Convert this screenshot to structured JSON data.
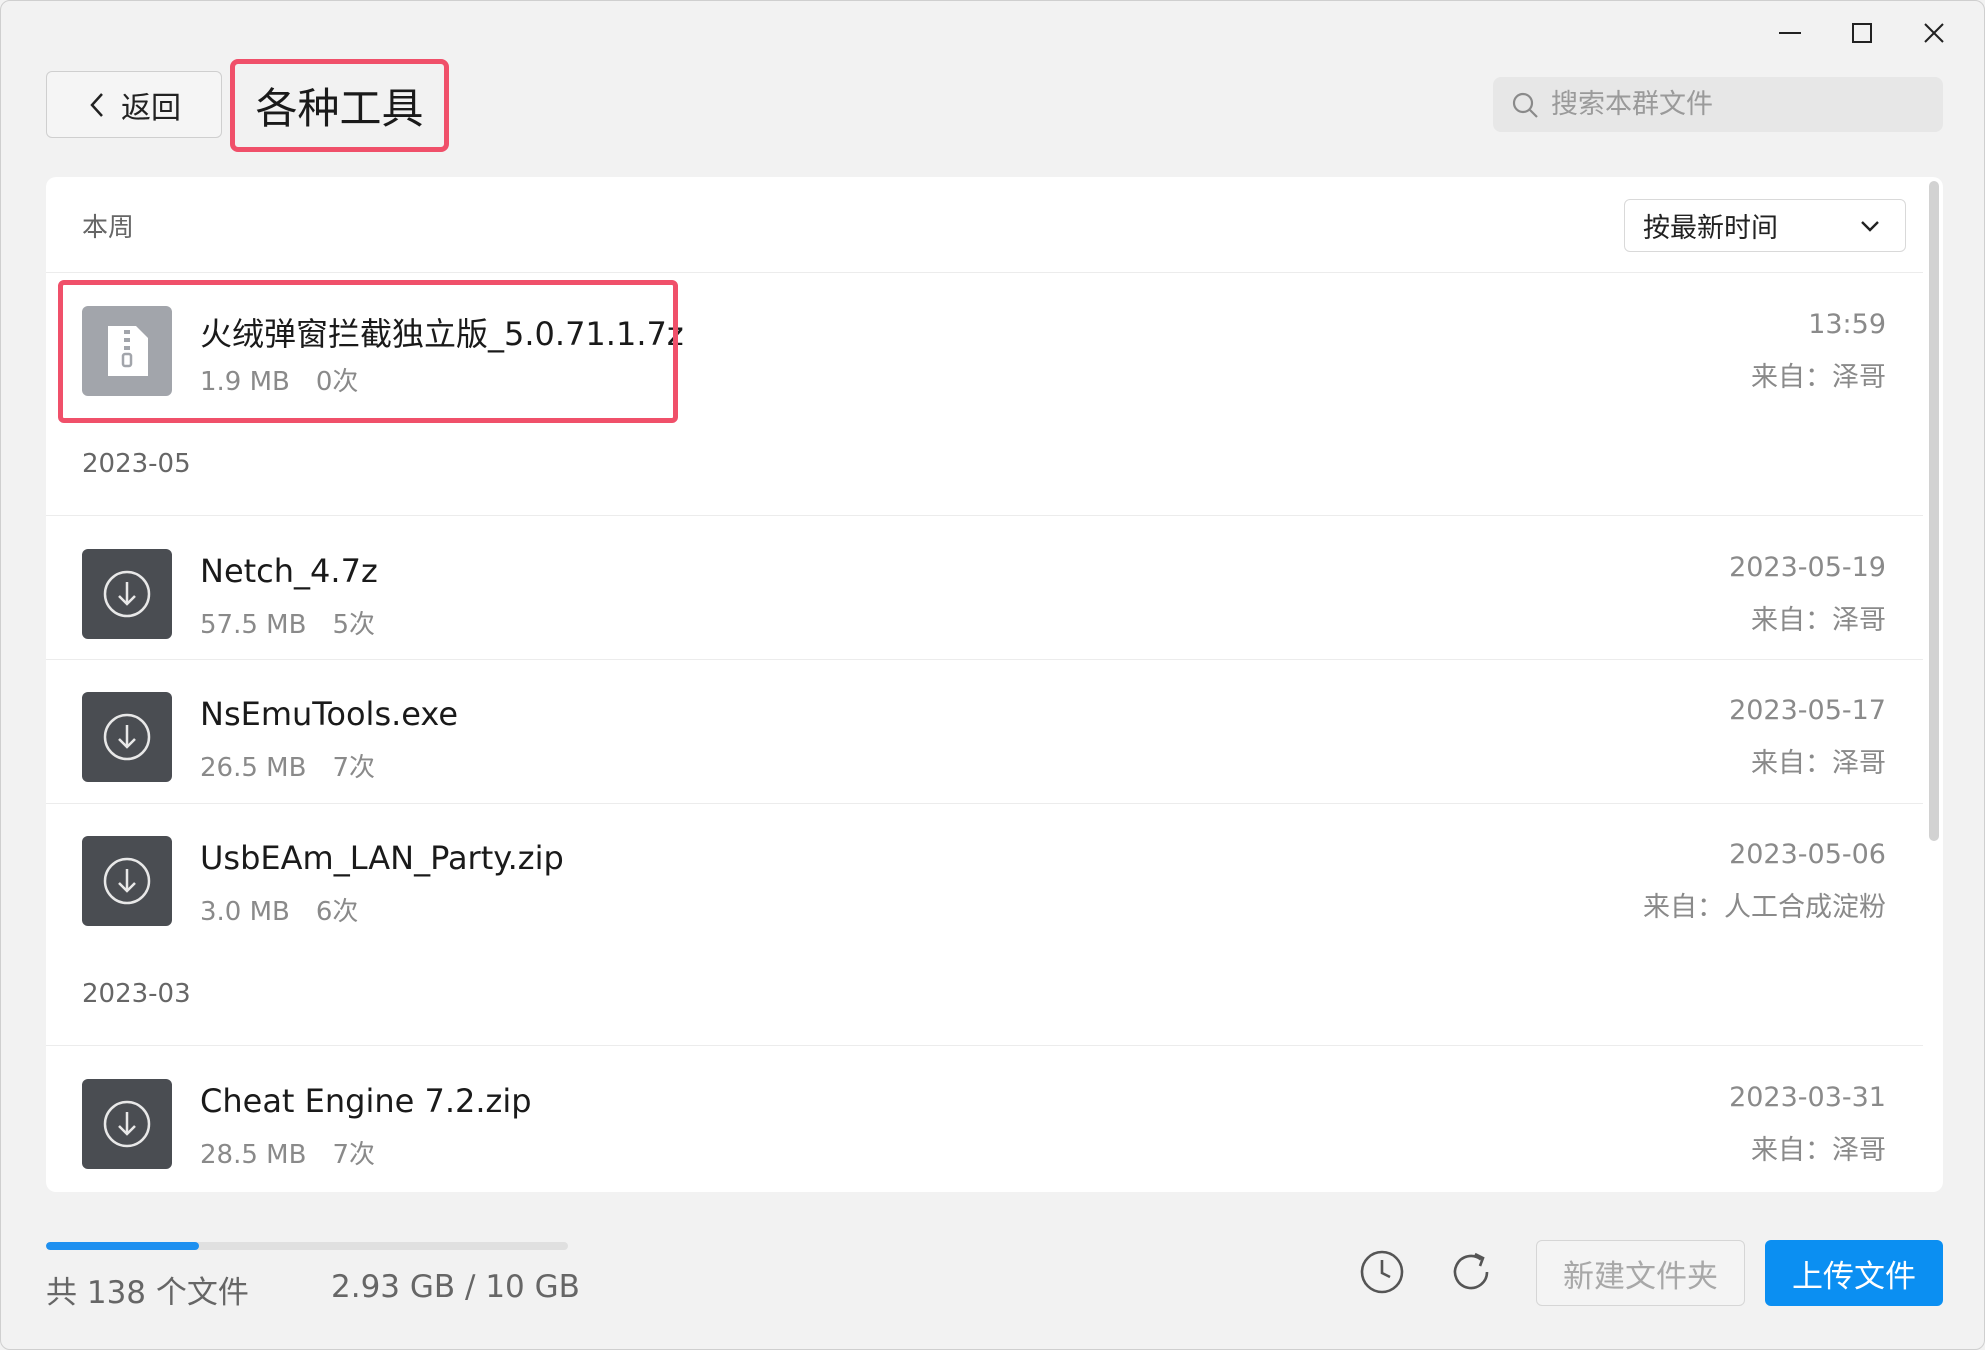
{
  "header": {
    "back_label": "返回",
    "folder_title": "各种工具",
    "search_placeholder": "搜索本群文件"
  },
  "sort": {
    "selected": "按最新时间"
  },
  "sections": [
    {
      "label": "本周",
      "files": [
        {
          "name": "火绒弹窗拦截独立版_5.0.71.1.7z",
          "size": "1.9 MB",
          "count": "0次",
          "date": "13:59",
          "from": "来自：泽哥",
          "icon": "archive-file-icon",
          "highlighted": true
        }
      ]
    },
    {
      "label": "2023-05",
      "files": [
        {
          "name": "Netch_4.7z",
          "size": "57.5 MB",
          "count": "5次",
          "date": "2023-05-19",
          "from": "来自：泽哥",
          "icon": "download-icon"
        },
        {
          "name": "NsEmuTools.exe",
          "size": "26.5 MB",
          "count": "7次",
          "date": "2023-05-17",
          "from": "来自：泽哥",
          "icon": "download-icon"
        },
        {
          "name": "UsbEAm_LAN_Party.zip",
          "size": "3.0 MB",
          "count": "6次",
          "date": "2023-05-06",
          "from": "来自：人工合成淀粉",
          "icon": "download-icon"
        }
      ]
    },
    {
      "label": "2023-03",
      "files": [
        {
          "name": "Cheat Engine 7.2.zip",
          "size": "28.5 MB",
          "count": "7次",
          "date": "2023-03-31",
          "from": "来自：泽哥",
          "icon": "download-icon"
        }
      ]
    }
  ],
  "footer": {
    "file_count": "共 138 个文件",
    "storage": "2.93 GB / 10 GB",
    "storage_fraction": 0.293,
    "new_folder_label": "新建文件夹",
    "upload_label": "上传文件"
  },
  "colors": {
    "accent": "#0b8ff2",
    "highlight": "#f0506a"
  }
}
